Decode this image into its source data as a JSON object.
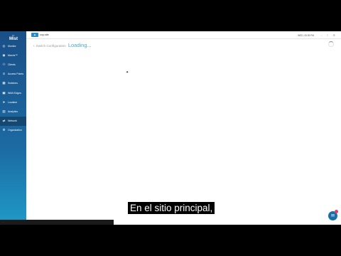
{
  "sidebar": {
    "logo_text": "Mist",
    "items": [
      {
        "label": "Monitor",
        "icon": "monitor-icon",
        "glyph": "◎"
      },
      {
        "label": "Marvis™",
        "icon": "marvis-icon",
        "glyph": "◉"
      },
      {
        "label": "Clients",
        "icon": "clients-icon",
        "glyph": "⚇"
      },
      {
        "label": "Access Points",
        "icon": "access-points-icon",
        "glyph": "⊙"
      },
      {
        "label": "Switches",
        "icon": "switches-icon",
        "glyph": "▦"
      },
      {
        "label": "WAN Edges",
        "icon": "wan-edges-icon",
        "glyph": "▣"
      },
      {
        "label": "Location",
        "icon": "location-icon",
        "glyph": "➤"
      },
      {
        "label": "Analytics",
        "icon": "analytics-icon",
        "glyph": "▥"
      },
      {
        "label": "Network",
        "icon": "network-icon",
        "glyph": "⇄"
      },
      {
        "label": "Organization",
        "icon": "organization-icon",
        "glyph": "⚙"
      }
    ],
    "active_index": 8
  },
  "topbar": {
    "brand_name": "cop-site",
    "clock": "WED, 05:39 PM"
  },
  "main": {
    "back_arrow": "‹",
    "crumb_label": "Switch Configuration",
    "loading_text": "Loading..."
  },
  "caption": "En el sitio principal,"
}
